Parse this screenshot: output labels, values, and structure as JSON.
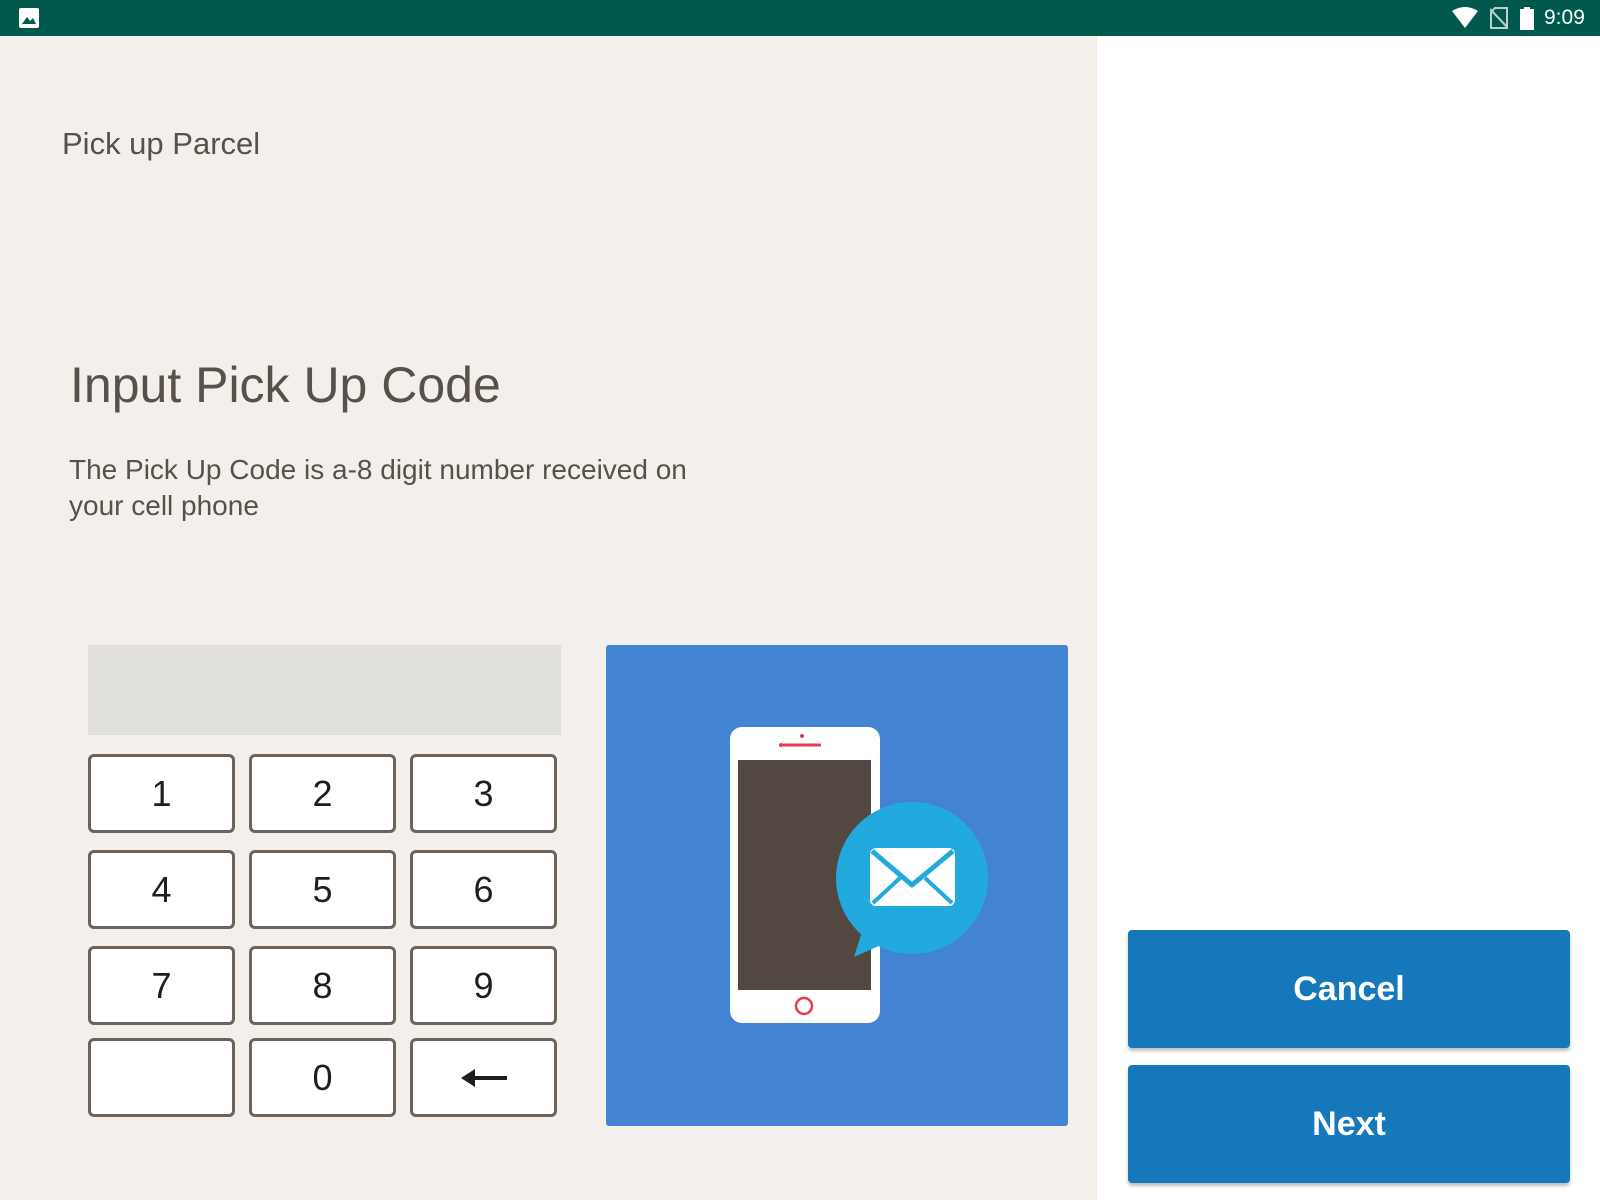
{
  "status_bar": {
    "time": "9:09",
    "icons": [
      "image-icon",
      "wifi-icon",
      "no-sim-icon",
      "battery-icon"
    ],
    "background": "#00594C"
  },
  "header": {
    "app_title": "Pick up Parcel"
  },
  "main": {
    "title": "Input Pick Up Code",
    "instruction": "The Pick Up Code is a-8 digit number received on your cell phone",
    "code_value": "",
    "keypad": {
      "keys": [
        "1",
        "2",
        "3",
        "4",
        "5",
        "6",
        "7",
        "8",
        "9",
        "",
        "0"
      ],
      "backspace_icon": "left-arrow-icon"
    },
    "illustration": {
      "icons": [
        "phone-icon",
        "envelope-icon"
      ],
      "background": "#4283D2"
    }
  },
  "actions": {
    "cancel_label": "Cancel",
    "next_label": "Next",
    "color": "#1478BB"
  }
}
